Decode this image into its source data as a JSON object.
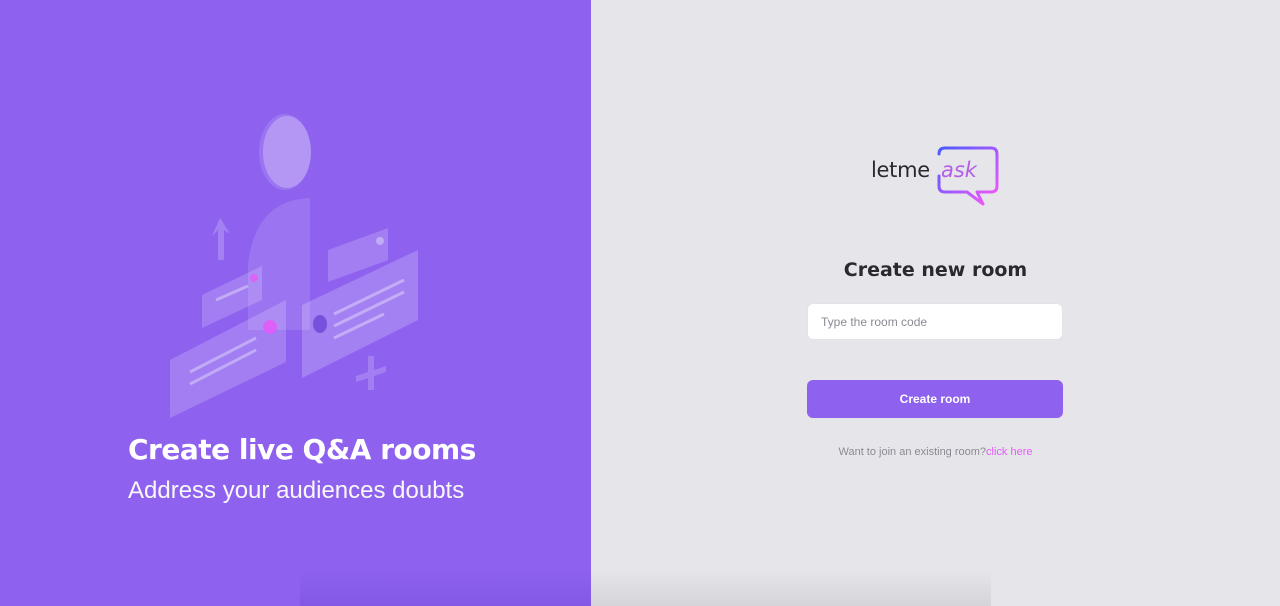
{
  "aside": {
    "title": "Create live Q&A rooms",
    "subtitle": "Address your audiences doubts",
    "illustration_icon": "qa-illustration"
  },
  "logo": {
    "text_dark": "letme",
    "text_accent": "ask",
    "accent_color": "#b35ee8"
  },
  "main": {
    "title": "Create new room",
    "input_placeholder": "Type the room code",
    "input_value": "",
    "create_button_label": "Create room",
    "join_prompt": "Want to join an existing room?",
    "join_link": "click here"
  },
  "colors": {
    "primary": "#8e62ef",
    "background": "#e6e6ea",
    "link": "#e559f9",
    "text_dark": "#29292e",
    "text_muted": "#8a8a94"
  }
}
